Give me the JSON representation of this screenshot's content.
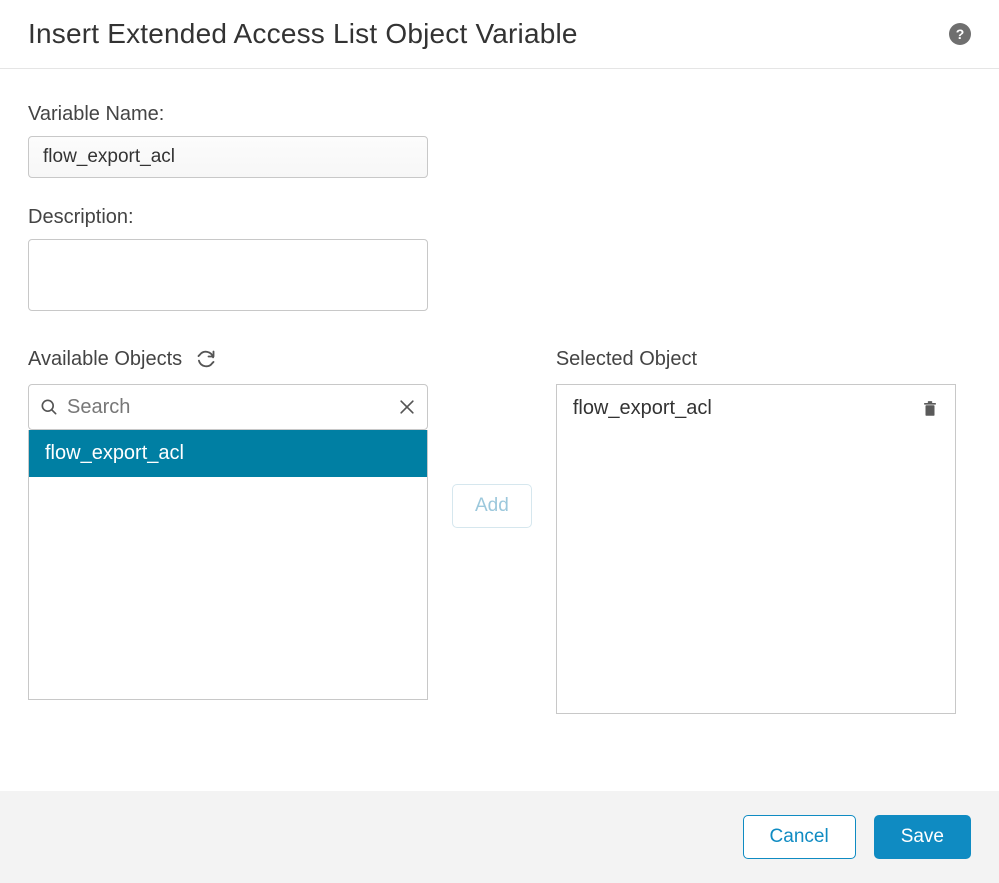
{
  "header": {
    "title": "Insert Extended Access List Object Variable"
  },
  "fields": {
    "variableName": {
      "label": "Variable Name:",
      "value": "flow_export_acl"
    },
    "description": {
      "label": "Description:",
      "value": ""
    }
  },
  "available": {
    "title": "Available Objects",
    "searchPlaceholder": "Search",
    "items": [
      {
        "label": "flow_export_acl",
        "selected": true
      }
    ]
  },
  "selected": {
    "title": "Selected Object",
    "items": [
      {
        "label": "flow_export_acl"
      }
    ]
  },
  "buttons": {
    "add": "Add",
    "cancel": "Cancel",
    "save": "Save"
  }
}
